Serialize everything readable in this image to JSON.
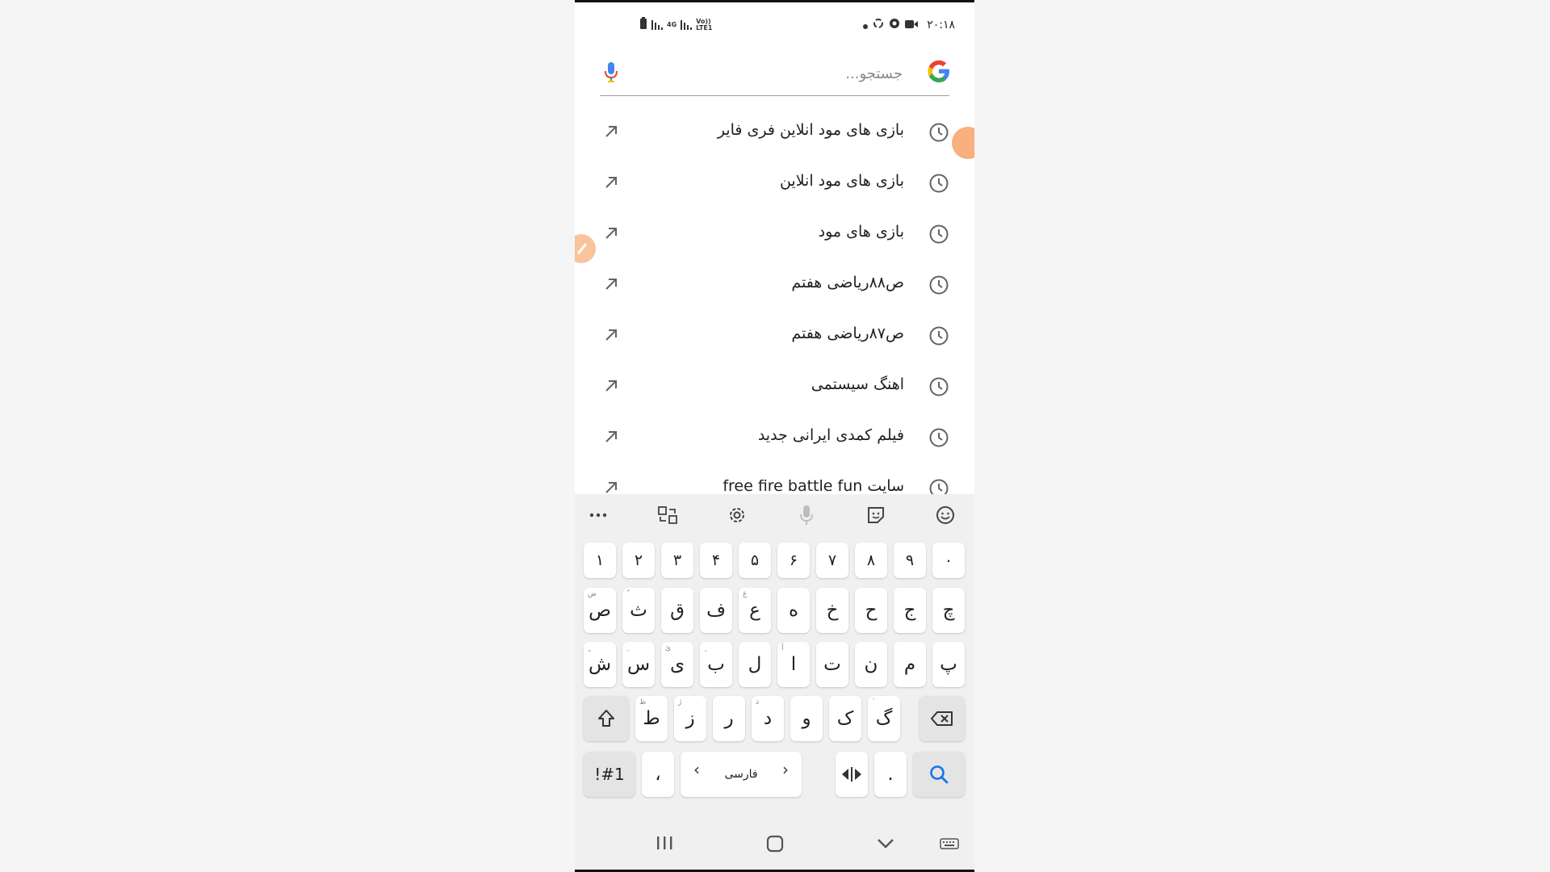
{
  "status_bar": {
    "time": "۲۰:۱۸",
    "left_labels": [
      "4G",
      "Vo))",
      "LTE1"
    ]
  },
  "search": {
    "placeholder": "جستجو..."
  },
  "suggestions": [
    {
      "text": "بازی های مود انلاین فری فایر"
    },
    {
      "text": "بازی های مود انلاین"
    },
    {
      "text": "بازی های مود"
    },
    {
      "text": "ص۸۸ریاضی هفتم"
    },
    {
      "text": "ص۸۷ریاضی هفتم"
    },
    {
      "text": "اهنگ سیستمی"
    },
    {
      "text": "فیلم کمدی ایرانی جدید"
    },
    {
      "text": "سایت free fire battle fun"
    }
  ],
  "keyboard": {
    "toolbar_icons": [
      "more-icon",
      "translate-icon",
      "settings-icon",
      "mic-icon",
      "sticker-icon",
      "emoji-icon"
    ],
    "row_numbers": [
      "۱",
      "۲",
      "۳",
      "۴",
      "۵",
      "۶",
      "۷",
      "۸",
      "۹",
      "۰"
    ],
    "row1": [
      {
        "key": "ص",
        "hint": "ض"
      },
      {
        "key": "ث",
        "hint": "ٌ"
      },
      {
        "key": "ق",
        "hint": ""
      },
      {
        "key": "ف",
        "hint": ""
      },
      {
        "key": "ع",
        "hint": "غ"
      },
      {
        "key": "ه",
        "hint": ""
      },
      {
        "key": "خ",
        "hint": ""
      },
      {
        "key": "ح",
        "hint": ""
      },
      {
        "key": "ج",
        "hint": ""
      },
      {
        "key": "چ",
        "hint": ""
      }
    ],
    "row2": [
      {
        "key": "ش",
        "hint": "ٍ"
      },
      {
        "key": "س",
        "hint": "ِ"
      },
      {
        "key": "ی",
        "hint": "ئ"
      },
      {
        "key": "ب",
        "hint": "ٕ"
      },
      {
        "key": "ل",
        "hint": ""
      },
      {
        "key": "ا",
        "hint": "آ"
      },
      {
        "key": "ت",
        "hint": ""
      },
      {
        "key": "ن",
        "hint": ""
      },
      {
        "key": "م",
        "hint": ""
      },
      {
        "key": "پ",
        "hint": ""
      }
    ],
    "row3": [
      {
        "key": "ط",
        "hint": "ظ"
      },
      {
        "key": "ز",
        "hint": "ژ"
      },
      {
        "key": "ر",
        "hint": ""
      },
      {
        "key": "د",
        "hint": "ذ"
      },
      {
        "key": "و",
        "hint": ""
      },
      {
        "key": "ک",
        "hint": ""
      },
      {
        "key": "گ",
        "hint": "ٔ"
      }
    ],
    "symbols_label": "!#1",
    "comma": "،",
    "space_label": "فارسی",
    "period": ".",
    "chev_left": "‹",
    "chev_right": "›"
  },
  "colors": {
    "bubble": "#f7b07e",
    "search_blue": "#1a73e8"
  }
}
